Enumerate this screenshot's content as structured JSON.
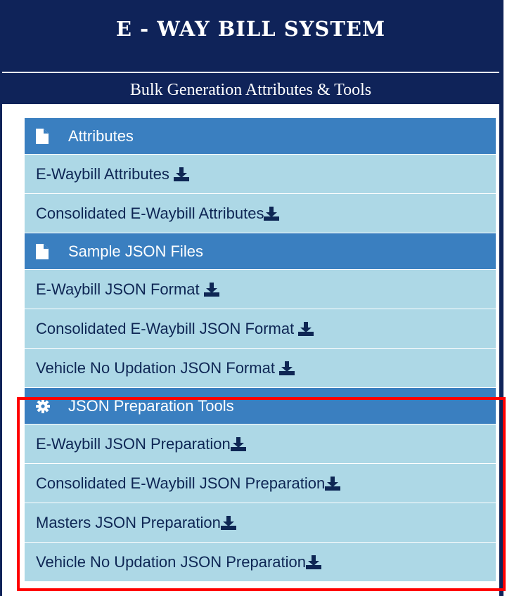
{
  "title": "E - WAY BILL SYSTEM",
  "subtitle": "Bulk Generation Attributes & Tools",
  "sections": [
    {
      "header": "Attributes",
      "icon": "file-icon",
      "items": [
        "E-Waybill Attributes",
        "Consolidated E-Waybill Attributes"
      ]
    },
    {
      "header": "Sample JSON Files",
      "icon": "file-icon",
      "items": [
        "E-Waybill JSON Format",
        "Consolidated E-Waybill JSON Format",
        "Vehicle No Updation JSON Format"
      ]
    },
    {
      "header": "JSON Preparation Tools",
      "icon": "gear-icon",
      "items": [
        "E-Waybill JSON Preparation",
        "Consolidated E-Waybill JSON Preparation",
        "Masters JSON Preparation",
        "Vehicle No Updation JSON Preparation"
      ]
    }
  ],
  "colors": {
    "navy": "#0f2359",
    "header_blue": "#3a7fc0",
    "item_bg": "#add8e6",
    "highlight": "#ff0000"
  }
}
